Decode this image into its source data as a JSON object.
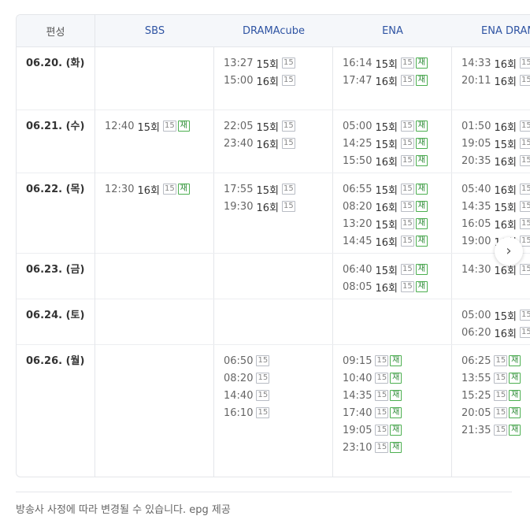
{
  "header": {
    "label": "편성",
    "channels": [
      "SBS",
      "DRAMAcube",
      "ENA",
      "ENA DRAMA"
    ]
  },
  "rows": [
    {
      "date": "06.20. (화)",
      "cells": [
        [],
        [
          {
            "time": "13:27",
            "ep": "15회",
            "rating": "15",
            "rerun": ""
          },
          {
            "time": "15:00",
            "ep": "16회",
            "rating": "15",
            "rerun": ""
          }
        ],
        [
          {
            "time": "16:14",
            "ep": "15회",
            "rating": "15",
            "rerun": "재"
          },
          {
            "time": "17:47",
            "ep": "16회",
            "rating": "15",
            "rerun": "재"
          }
        ],
        [
          {
            "time": "14:33",
            "ep": "16회",
            "rating": "15",
            "rerun": ""
          },
          {
            "time": "20:11",
            "ep": "16회",
            "rating": "15",
            "rerun": ""
          }
        ]
      ]
    },
    {
      "date": "06.21. (수)",
      "cells": [
        [
          {
            "time": "12:40",
            "ep": "15회",
            "rating": "15",
            "rerun": "재"
          }
        ],
        [
          {
            "time": "22:05",
            "ep": "15회",
            "rating": "15",
            "rerun": ""
          },
          {
            "time": "23:40",
            "ep": "16회",
            "rating": "15",
            "rerun": ""
          }
        ],
        [
          {
            "time": "05:00",
            "ep": "15회",
            "rating": "15",
            "rerun": "재"
          },
          {
            "time": "14:25",
            "ep": "15회",
            "rating": "15",
            "rerun": "재"
          },
          {
            "time": "15:50",
            "ep": "16회",
            "rating": "15",
            "rerun": "재"
          }
        ],
        [
          {
            "time": "01:50",
            "ep": "16회",
            "rating": "15",
            "rerun": ""
          },
          {
            "time": "19:05",
            "ep": "15회",
            "rating": "15",
            "rerun": ""
          },
          {
            "time": "20:35",
            "ep": "16회",
            "rating": "15",
            "rerun": ""
          }
        ]
      ]
    },
    {
      "date": "06.22. (목)",
      "cells": [
        [
          {
            "time": "12:30",
            "ep": "16회",
            "rating": "15",
            "rerun": "재"
          }
        ],
        [
          {
            "time": "17:55",
            "ep": "15회",
            "rating": "15",
            "rerun": ""
          },
          {
            "time": "19:30",
            "ep": "16회",
            "rating": "15",
            "rerun": ""
          }
        ],
        [
          {
            "time": "06:55",
            "ep": "15회",
            "rating": "15",
            "rerun": "재"
          },
          {
            "time": "08:20",
            "ep": "16회",
            "rating": "15",
            "rerun": "재"
          },
          {
            "time": "13:20",
            "ep": "15회",
            "rating": "15",
            "rerun": "재"
          },
          {
            "time": "14:45",
            "ep": "16회",
            "rating": "15",
            "rerun": "재"
          }
        ],
        [
          {
            "time": "05:40",
            "ep": "16회",
            "rating": "15",
            "rerun": ""
          },
          {
            "time": "14:35",
            "ep": "15회",
            "rating": "15",
            "rerun": ""
          },
          {
            "time": "16:05",
            "ep": "16회",
            "rating": "15",
            "rerun": ""
          },
          {
            "time": "19:00",
            "ep": "16회",
            "rating": "15",
            "rerun": ""
          }
        ]
      ]
    },
    {
      "date": "06.23. (금)",
      "cells": [
        [],
        [],
        [
          {
            "time": "06:40",
            "ep": "15회",
            "rating": "15",
            "rerun": "재"
          },
          {
            "time": "08:05",
            "ep": "16회",
            "rating": "15",
            "rerun": "재"
          }
        ],
        [
          {
            "time": "14:30",
            "ep": "16회",
            "rating": "15",
            "rerun": ""
          }
        ]
      ]
    },
    {
      "date": "06.24. (토)",
      "cells": [
        [],
        [],
        [],
        [
          {
            "time": "05:00",
            "ep": "15회",
            "rating": "15",
            "rerun": ""
          },
          {
            "time": "06:20",
            "ep": "16회",
            "rating": "15",
            "rerun": ""
          }
        ]
      ]
    },
    {
      "date": "06.26. (월)",
      "cells": [
        [],
        [
          {
            "time": "06:50",
            "ep": "",
            "rating": "15",
            "rerun": ""
          },
          {
            "time": "08:20",
            "ep": "",
            "rating": "15",
            "rerun": ""
          },
          {
            "time": "14:40",
            "ep": "",
            "rating": "15",
            "rerun": ""
          },
          {
            "time": "16:10",
            "ep": "",
            "rating": "15",
            "rerun": ""
          }
        ],
        [
          {
            "time": "09:15",
            "ep": "",
            "rating": "15",
            "rerun": "재"
          },
          {
            "time": "10:40",
            "ep": "",
            "rating": "15",
            "rerun": "재"
          },
          {
            "time": "14:35",
            "ep": "",
            "rating": "15",
            "rerun": "재"
          },
          {
            "time": "17:40",
            "ep": "",
            "rating": "15",
            "rerun": "재"
          },
          {
            "time": "19:05",
            "ep": "",
            "rating": "15",
            "rerun": "재"
          },
          {
            "time": "23:10",
            "ep": "",
            "rating": "15",
            "rerun": "재"
          }
        ],
        [
          {
            "time": "06:25",
            "ep": "",
            "rating": "15",
            "rerun": "재"
          },
          {
            "time": "13:55",
            "ep": "",
            "rating": "15",
            "rerun": "재"
          },
          {
            "time": "15:25",
            "ep": "",
            "rating": "15",
            "rerun": "재"
          },
          {
            "time": "20:05",
            "ep": "",
            "rating": "15",
            "rerun": "재"
          },
          {
            "time": "21:35",
            "ep": "",
            "rating": "15",
            "rerun": "재"
          }
        ]
      ]
    }
  ],
  "next_button_icon": "chevron-right-icon",
  "footnote": "방송사 사정에 따라 변경될 수 있습니다. epg 제공"
}
